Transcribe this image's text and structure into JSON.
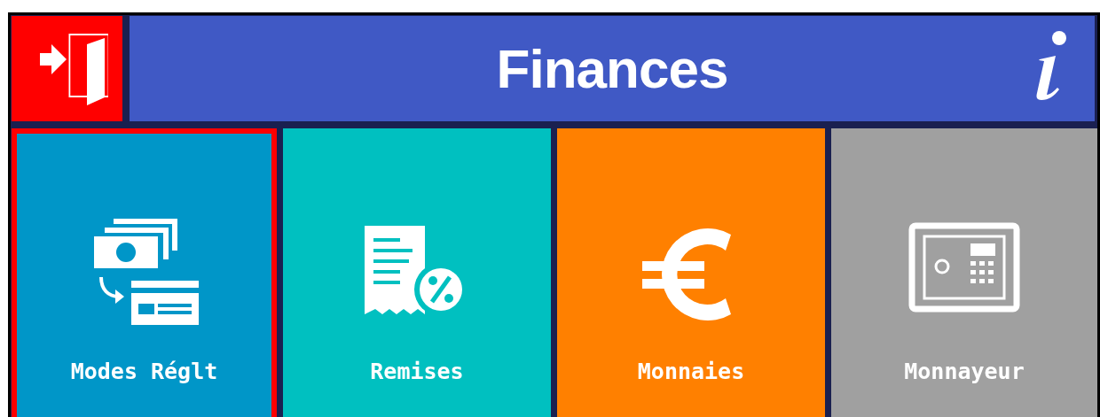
{
  "header": {
    "title": "Finances"
  },
  "tiles": [
    {
      "kind": "payment",
      "label": "Modes Réglt",
      "color": "#0096c8",
      "selected": true
    },
    {
      "kind": "discount",
      "label": "Remises",
      "color": "#00c0c0",
      "selected": false
    },
    {
      "kind": "currency",
      "label": "Monnaies",
      "color": "#ff8000",
      "selected": false
    },
    {
      "kind": "safe",
      "label": "Monnayeur",
      "color": "#a0a0a0",
      "selected": false
    }
  ]
}
